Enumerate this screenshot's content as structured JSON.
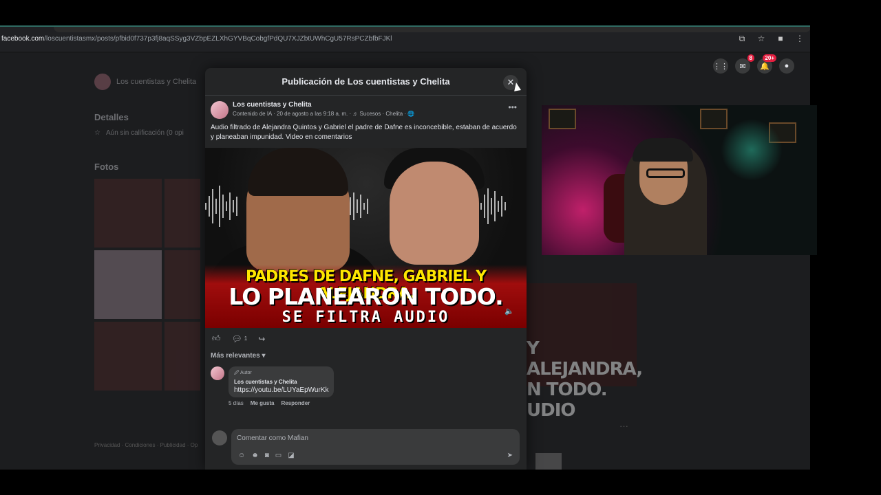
{
  "browser": {
    "url_host": "facebook.com",
    "url_path": "/loscuentistasmx/posts/pfbid0f737p3fj8aqSSyg3VZbpEZLXhGYVBqCobgfPdQU7XJZbtUWhCgU57RsPCZbfbFJKl"
  },
  "fb_header": {
    "messenger_badge": "8",
    "notifications_badge": "20+"
  },
  "background": {
    "page_name": "Los cuentistas y Chelita",
    "details_heading": "Detalles",
    "rating_text": "Aún sin calificación (0 opi",
    "photos_heading": "Fotos",
    "footer_links": "Privacidad · Condiciones · Publicidad · Op",
    "right_thumb_text": "Y ALEJANDRA, N TODO. UDIO"
  },
  "modal": {
    "title": "Publicación de Los cuentistas y Chelita",
    "close_label": "✕",
    "post": {
      "author": "Los cuentistas y Chelita",
      "meta": "Contenido de IA · 20 de agosto a las 9:18 a. m. · ♬ Sucesos · Chelita · 🌐",
      "text": "Audio filtrado de Alejandra Quintos y Gabriel el padre de Dafne es inconcebible,  estaban de acuerdo y planeaban impunidad. Video en comentarios",
      "thumb_line1": "PADRES DE DAFNE, GABRIEL Y ALEJANDRA,",
      "thumb_line2": "LO PLANEARON TODO.",
      "thumb_line3": "SE FILTRA AUDIO"
    },
    "actions": {
      "comment_count": "1"
    },
    "sort_label": "Más relevantes ▾",
    "comment": {
      "role": "🖉 Autor",
      "author": "Los cuentistas y Chelita",
      "text": "https://youtu.be/LUYaEpWurKk",
      "time": "5 días",
      "like": "Me gusta",
      "reply": "Responder"
    },
    "composer": {
      "placeholder": "Comentar como Mafian"
    }
  }
}
